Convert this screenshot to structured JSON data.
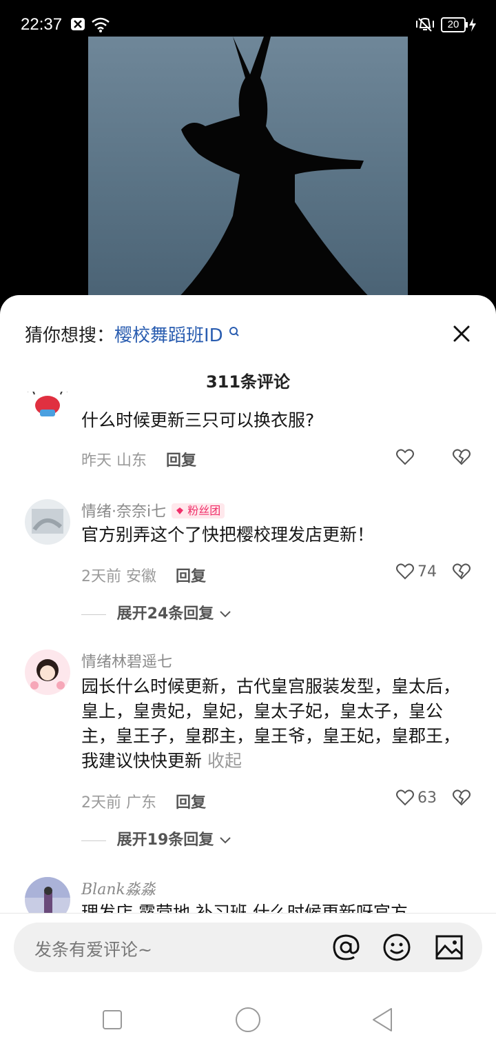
{
  "status_bar": {
    "time": "22:37",
    "battery": "20"
  },
  "search_suggest": {
    "prefix": "猜你想搜：",
    "query": "樱校舞蹈班ID"
  },
  "comments_count": "311条评论",
  "comments": [
    {
      "text": "什么时候更新三只可以换衣服?",
      "time": "昨天",
      "location": "山东",
      "reply": "回复"
    },
    {
      "user": "情绪·奈奈i七",
      "badge": "粉丝团",
      "text": "官方别弄这个了快把樱校理发店更新！",
      "time": "2天前",
      "location": "安徽",
      "reply": "回复",
      "likes": "74",
      "expand": "展开24条回复"
    },
    {
      "user": "情绪林碧遥七",
      "text": "园长什么时候更新，古代皇宫服装发型，皇太后，皇上，皇贵妃，皇妃，皇太子妃，皇太子，皇公主，皇王子，皇郡主，皇王爷，皇王妃，皇郡王，我建议快快更新",
      "fold": "收起",
      "time": "2天前",
      "location": "广东",
      "reply": "回复",
      "likes": "63",
      "expand": "展开19条回复"
    },
    {
      "user": "Blank淼淼",
      "text": "理发店 露营地 补习班 什么时候更新呀官方"
    }
  ],
  "input": {
    "placeholder": "发条有爱评论~"
  }
}
